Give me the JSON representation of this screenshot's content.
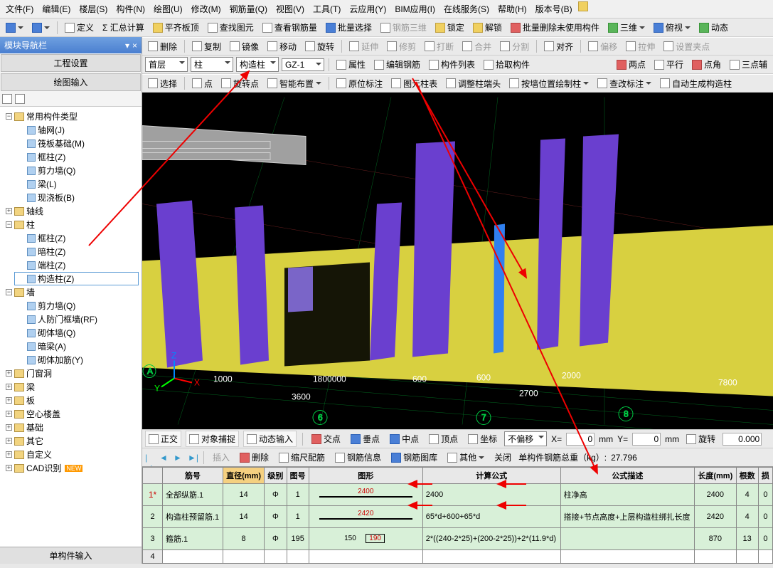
{
  "menus": [
    "文件(F)",
    "编辑(E)",
    "楼层(S)",
    "构件(N)",
    "绘图(U)",
    "修改(M)",
    "钢筋量(Q)",
    "视图(V)",
    "工具(T)",
    "云应用(Y)",
    "BIM应用(I)",
    "在线服务(S)",
    "帮助(H)",
    "版本号(B)"
  ],
  "toolbar1": [
    {
      "t": "定义",
      "n": "define"
    },
    {
      "t": "Σ 汇总计算",
      "n": "summary-calc"
    },
    {
      "t": "平齐板顶",
      "n": "align-slab"
    },
    {
      "t": "查找图元",
      "n": "find-elem"
    },
    {
      "t": "查看钢筋量",
      "n": "view-rebar"
    },
    {
      "t": "批量选择",
      "n": "batch-select"
    },
    {
      "t": "钢筋三维",
      "n": "rebar-3d"
    },
    {
      "t": "锁定",
      "n": "lock"
    },
    {
      "t": "解锁",
      "n": "unlock"
    },
    {
      "t": "批量删除未使用构件",
      "n": "batch-delete-unused"
    },
    {
      "t": "三维",
      "n": "3d-view"
    },
    {
      "t": "俯视",
      "n": "top-view"
    },
    {
      "t": "动态",
      "n": "dynamic"
    }
  ],
  "toolbar_edit": [
    {
      "t": "删除",
      "n": "delete"
    },
    {
      "t": "复制",
      "n": "copy"
    },
    {
      "t": "镜像",
      "n": "mirror"
    },
    {
      "t": "移动",
      "n": "move"
    },
    {
      "t": "旋转",
      "n": "rotate"
    },
    {
      "t": "延伸",
      "n": "extend"
    },
    {
      "t": "修剪",
      "n": "trim"
    },
    {
      "t": "打断",
      "n": "break"
    },
    {
      "t": "合并",
      "n": "merge"
    },
    {
      "t": "分割",
      "n": "split"
    },
    {
      "t": "对齐",
      "n": "align"
    },
    {
      "t": "偏移",
      "n": "offset"
    },
    {
      "t": "拉伸",
      "n": "stretch"
    },
    {
      "t": "设置夹点",
      "n": "set-grip"
    }
  ],
  "sel_row": {
    "floor": "首层",
    "cat": "柱",
    "subcat": "构造柱",
    "member": "GZ-1",
    "btns": [
      {
        "t": "属性",
        "n": "props"
      },
      {
        "t": "编辑钢筋",
        "n": "edit-rebar"
      },
      {
        "t": "构件列表",
        "n": "member-list"
      },
      {
        "t": "拾取构件",
        "n": "pick-member"
      }
    ],
    "right": [
      {
        "t": "两点",
        "n": "two-point"
      },
      {
        "t": "平行",
        "n": "parallel"
      },
      {
        "t": "点角",
        "n": "point-angle"
      },
      {
        "t": "三点辅",
        "n": "three-point"
      }
    ]
  },
  "toolbar_draw": [
    {
      "t": "选择",
      "n": "select"
    },
    {
      "t": "点",
      "n": "point"
    },
    {
      "t": "旋转点",
      "n": "rotate-point"
    },
    {
      "t": "智能布置",
      "n": "smart-layout"
    },
    {
      "t": "原位标注",
      "n": "in-place-dim"
    },
    {
      "t": "图元柱表",
      "n": "column-table"
    },
    {
      "t": "调整柱端头",
      "n": "adjust-col-end"
    },
    {
      "t": "按墙位置绘制柱",
      "n": "draw-col-by-wall"
    },
    {
      "t": "查改标注",
      "n": "check-dim"
    },
    {
      "t": "自动生成构造柱",
      "n": "auto-gen-constr-col"
    }
  ],
  "nav": {
    "title": "模块导航栏",
    "sections": [
      "工程设置",
      "绘图输入"
    ]
  },
  "tree": {
    "root": "常用构件类型",
    "root_children": [
      {
        "t": "轴网(J)"
      },
      {
        "t": "筏板基础(M)"
      },
      {
        "t": "框柱(Z)"
      },
      {
        "t": "剪力墙(Q)"
      },
      {
        "t": "梁(L)"
      },
      {
        "t": "现浇板(B)"
      }
    ],
    "groups": [
      {
        "t": "轴线",
        "children": []
      },
      {
        "t": "柱",
        "exp": true,
        "children": [
          {
            "t": "框柱(Z)"
          },
          {
            "t": "暗柱(Z)"
          },
          {
            "t": "端柱(Z)"
          },
          {
            "t": "构造柱(Z)",
            "sel": true
          }
        ]
      },
      {
        "t": "墙",
        "exp": true,
        "children": [
          {
            "t": "剪力墙(Q)"
          },
          {
            "t": "人防门框墙(RF)"
          },
          {
            "t": "砌体墙(Q)"
          },
          {
            "t": "暗梁(A)"
          },
          {
            "t": "砌体加筋(Y)"
          }
        ]
      },
      {
        "t": "门窗洞"
      },
      {
        "t": "梁"
      },
      {
        "t": "板"
      },
      {
        "t": "空心楼盖"
      },
      {
        "t": "基础"
      },
      {
        "t": "其它"
      },
      {
        "t": "自定义"
      },
      {
        "t": "CAD识别",
        "new": true
      }
    ]
  },
  "bottom_status": "单构件输入",
  "viewport": {
    "dims": [
      "1000",
      "1800000",
      "600",
      "600",
      "2000",
      "7800",
      "3600",
      "2700"
    ],
    "grid_labels": [
      "6",
      "7",
      "8",
      "A"
    ]
  },
  "status_bar": {
    "toggles": [
      {
        "t": "正交",
        "n": "ortho"
      },
      {
        "t": "对象捕捉",
        "n": "osnap"
      },
      {
        "t": "动态输入",
        "n": "dyn-input"
      }
    ],
    "pts": [
      {
        "t": "交点",
        "n": "intxn"
      },
      {
        "t": "垂点",
        "n": "perp"
      },
      {
        "t": "中点",
        "n": "mid"
      },
      {
        "t": "顶点",
        "n": "vertex"
      },
      {
        "t": "坐标",
        "n": "coord"
      }
    ],
    "combo": "不偏移",
    "x_lbl": "X=",
    "x_val": "0",
    "mm": "mm",
    "y_lbl": "Y=",
    "y_val": "0",
    "rot_lbl": "旋转",
    "rot_val": "0.000"
  },
  "grid_tb": {
    "btns": [
      {
        "t": "插入",
        "n": "insert"
      },
      {
        "t": "删除",
        "n": "delete"
      },
      {
        "t": "缩尺配筋",
        "n": "scale-rebar"
      },
      {
        "t": "钢筋信息",
        "n": "rebar-info"
      },
      {
        "t": "钢筋图库",
        "n": "rebar-lib"
      },
      {
        "t": "其他",
        "n": "other"
      },
      {
        "t": "关闭",
        "n": "close"
      }
    ],
    "weight_lbl": "单构件钢筋总重（kg）:",
    "weight_val": "27.796"
  },
  "grid": {
    "cols": [
      "筋号",
      "直径(mm)",
      "级别",
      "图号",
      "图形",
      "计算公式",
      "公式描述",
      "长度(mm)",
      "根数",
      "损"
    ],
    "rows": [
      {
        "idx": "1*",
        "star": true,
        "name": "全部纵筋.1",
        "dia": "14",
        "grade": "Φ",
        "code": "1",
        "shape": "2400",
        "formula": "2400",
        "desc": "柱净高",
        "len": "2400",
        "num": "4",
        "loss": "0"
      },
      {
        "idx": "2",
        "name": "构造柱预留筋.1",
        "dia": "14",
        "grade": "Φ",
        "code": "1",
        "shape": "2420",
        "formula": "65*d+600+65*d",
        "desc": "搭接+节点高度+上层构造柱绑扎长度",
        "len": "2420",
        "num": "4",
        "loss": "0"
      },
      {
        "idx": "3",
        "name": "箍筋.1",
        "dia": "8",
        "grade": "Φ",
        "code": "195",
        "shape": "150 190",
        "formula": "2*((240-2*25)+(200-2*25))+2*(11.9*d)",
        "desc": "",
        "len": "870",
        "num": "13",
        "loss": "0"
      },
      {
        "idx": "4",
        "name": "",
        "dia": "",
        "grade": "",
        "code": "",
        "shape": "",
        "formula": "",
        "desc": "",
        "len": "",
        "num": "",
        "loss": ""
      }
    ]
  }
}
